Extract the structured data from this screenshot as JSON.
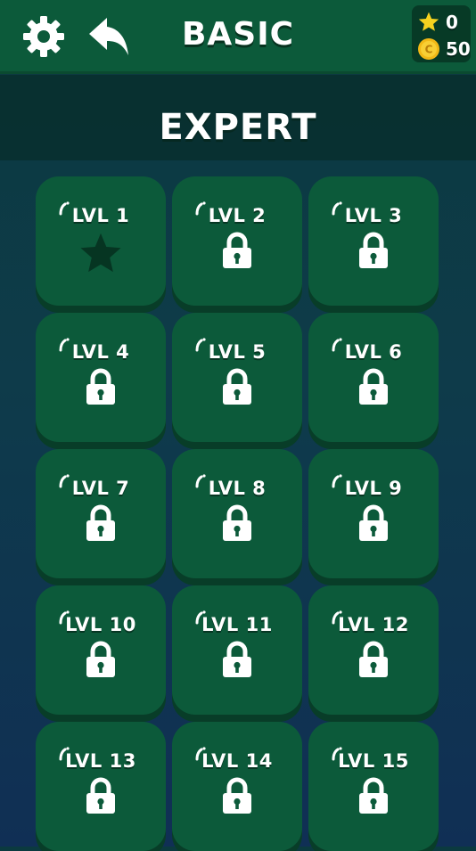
{
  "header": {
    "title": "BASIC",
    "settings_icon": "gear-icon",
    "back_icon": "back-arrow-icon"
  },
  "stats": {
    "stars": "0",
    "coins": "50",
    "star_icon": "star-icon",
    "coin_icon": "coin-icon",
    "coin_symbol": "C"
  },
  "section": {
    "title": "EXPERT"
  },
  "levels": [
    {
      "label": "LVL 1",
      "state": "star"
    },
    {
      "label": "LVL 2",
      "state": "locked"
    },
    {
      "label": "LVL 3",
      "state": "locked"
    },
    {
      "label": "LVL 4",
      "state": "locked"
    },
    {
      "label": "LVL 5",
      "state": "locked"
    },
    {
      "label": "LVL 6",
      "state": "locked"
    },
    {
      "label": "LVL 7",
      "state": "locked"
    },
    {
      "label": "LVL 8",
      "state": "locked"
    },
    {
      "label": "LVL 9",
      "state": "locked"
    },
    {
      "label": "LVL 10",
      "state": "locked"
    },
    {
      "label": "LVL 11",
      "state": "locked"
    },
    {
      "label": "LVL 12",
      "state": "locked"
    },
    {
      "label": "LVL 13",
      "state": "locked"
    },
    {
      "label": "LVL 14",
      "state": "locked"
    },
    {
      "label": "LVL 15",
      "state": "locked"
    }
  ],
  "colors": {
    "tile": "#0c5a3a",
    "header": "#0c5a3a",
    "star_gold": "#f6d21f",
    "star_empty": "#063522"
  }
}
